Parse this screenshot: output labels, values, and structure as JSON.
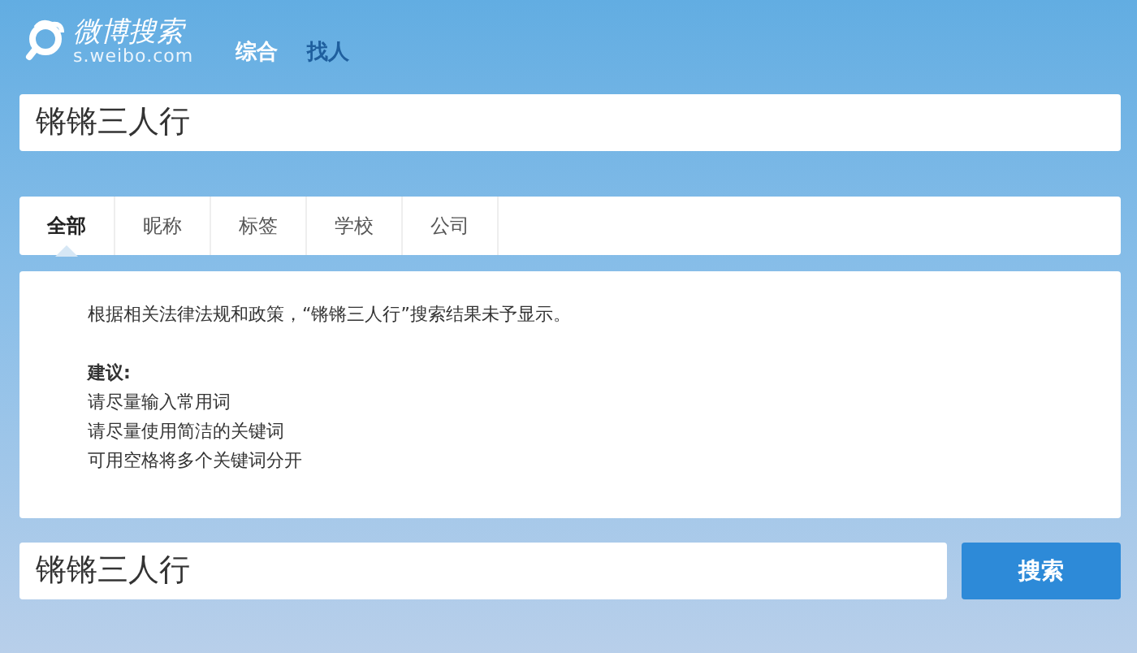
{
  "header": {
    "logo_title": "微博搜索",
    "logo_domain": "s.weibo.com",
    "nav": [
      {
        "label": "综合",
        "selected": false
      },
      {
        "label": "找人",
        "selected": true
      }
    ]
  },
  "top_search": {
    "value": "锵锵三人行"
  },
  "tabs": [
    {
      "label": "全部",
      "selected": true
    },
    {
      "label": "昵称",
      "selected": false
    },
    {
      "label": "标签",
      "selected": false
    },
    {
      "label": "学校",
      "selected": false
    },
    {
      "label": "公司",
      "selected": false
    }
  ],
  "notice": {
    "message": "根据相关法律法规和政策，“锵锵三人行”搜索结果未予显示。",
    "suggestion_title": "建议:",
    "suggestions": [
      "请尽量输入常用词",
      "请尽量使用简洁的关键词",
      "可用空格将多个关键词分开"
    ]
  },
  "bottom_search": {
    "value": "锵锵三人行",
    "button": "搜索"
  }
}
